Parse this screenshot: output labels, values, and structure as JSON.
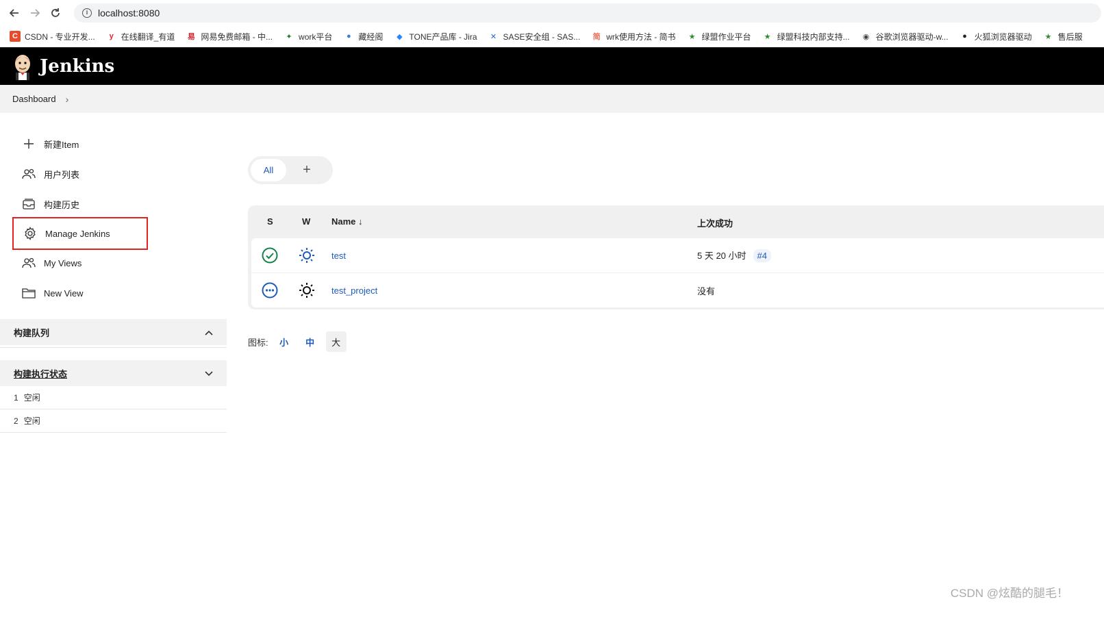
{
  "browser": {
    "url": "localhost:8080",
    "bookmarks": [
      {
        "label": "CSDN - 专业开发...",
        "icon": "csdn-icon",
        "color": "#e84a2c"
      },
      {
        "label": "在线翻译_有道",
        "icon": "youdao-icon",
        "color": "#e0262e"
      },
      {
        "label": "网易免费邮箱 - 中...",
        "icon": "netease-mail-icon",
        "color": "#d1232a"
      },
      {
        "label": "work平台",
        "icon": "work-icon",
        "color": "#2d7a2d"
      },
      {
        "label": "藏经阁",
        "icon": "chrome-icon",
        "color": "#3b7ddd"
      },
      {
        "label": "TONE产品库 - Jira",
        "icon": "jira-icon",
        "color": "#2684ff"
      },
      {
        "label": "SASE安全组 - SAS...",
        "icon": "confluence-icon",
        "color": "#1d6ae5"
      },
      {
        "label": "wrk使用方法 - 简书",
        "icon": "jianshu-icon",
        "color": "#ea6f5a"
      },
      {
        "label": "绿盟作业平台",
        "icon": "star-icon",
        "color": "#2e8b2e"
      },
      {
        "label": "绿盟科技内部支持...",
        "icon": "star-icon",
        "color": "#2e8b2e"
      },
      {
        "label": "谷歌浏览器驱动-w...",
        "icon": "globe-icon",
        "color": "#444444"
      },
      {
        "label": "火狐浏览器驱动",
        "icon": "github-icon",
        "color": "#222222"
      },
      {
        "label": "售后服",
        "icon": "star-icon",
        "color": "#2e8b2e"
      }
    ]
  },
  "header": {
    "title": "Jenkins"
  },
  "breadcrumb": {
    "item": "Dashboard",
    "separator": "›"
  },
  "sidebar": {
    "tasks": [
      {
        "label": "新建Item",
        "icon": "plus-icon"
      },
      {
        "label": "用户列表",
        "icon": "people-icon"
      },
      {
        "label": "构建历史",
        "icon": "history-icon"
      },
      {
        "label": "Manage Jenkins",
        "icon": "gear-icon"
      },
      {
        "label": "My Views",
        "icon": "people-icon"
      },
      {
        "label": "New View",
        "icon": "folder-icon"
      }
    ],
    "build_queue": {
      "title": "构建队列"
    },
    "executors": {
      "title": "构建执行状态",
      "rows": [
        {
          "num": "1",
          "status": "空闲"
        },
        {
          "num": "2",
          "status": "空闲"
        }
      ]
    }
  },
  "tabs": {
    "all": "All",
    "add": "+"
  },
  "table": {
    "headers": {
      "s": "S",
      "w": "W",
      "name": "Name ↓",
      "last_success": "上次成功"
    },
    "rows": [
      {
        "name": "test",
        "last_success": "5 天 20 小时",
        "build": "#4",
        "status": "success",
        "weather": "sunny"
      },
      {
        "name": "test_project",
        "last_success": "没有",
        "build": "",
        "status": "notbuilt",
        "weather": "sunny"
      }
    ]
  },
  "icon_size": {
    "label": "图标:",
    "small": "小",
    "medium": "中",
    "large": "大"
  },
  "watermark": "CSDN @炫酷的腿毛！",
  "colors": {
    "accent": "#1e5bb8",
    "success": "#138347",
    "highlight_box": "#e32222",
    "header_bg": "#000000"
  }
}
